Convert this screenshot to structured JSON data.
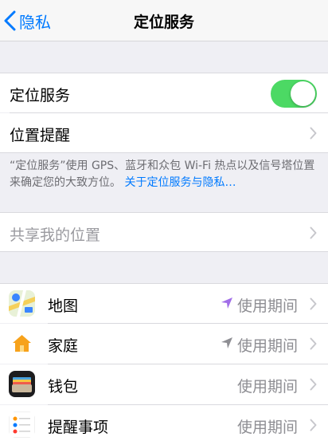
{
  "nav": {
    "back_label": "隐私",
    "title": "定位服务"
  },
  "location_services": {
    "label": "定位服务",
    "toggle_on": true,
    "toggle_color": "#4cd964"
  },
  "location_alerts": {
    "label": "位置提醒"
  },
  "footer": {
    "text": "“定位服务”使用 GPS、蓝牙和众包 Wi-Fi 热点以及信号塔位置来确定您的大致方位。",
    "link": "关于定位服务与隐私…"
  },
  "share_location": {
    "label": "共享我的位置"
  },
  "apps": [
    {
      "name": "地图",
      "icon": "maps-icon",
      "status": "使用期间",
      "arrow": "purple-location-arrow",
      "arrow_color": "#a16ee8"
    },
    {
      "name": "家庭",
      "icon": "home-icon",
      "status": "使用期间",
      "arrow": "gray-location-arrow",
      "arrow_color": "#8e8e93"
    },
    {
      "name": "钱包",
      "icon": "wallet-icon",
      "status": "使用期间"
    },
    {
      "name": "提醒事项",
      "icon": "reminders-icon",
      "status": "使用期间"
    }
  ],
  "colors": {
    "accent": "#007aff",
    "background": "#efeff4"
  }
}
